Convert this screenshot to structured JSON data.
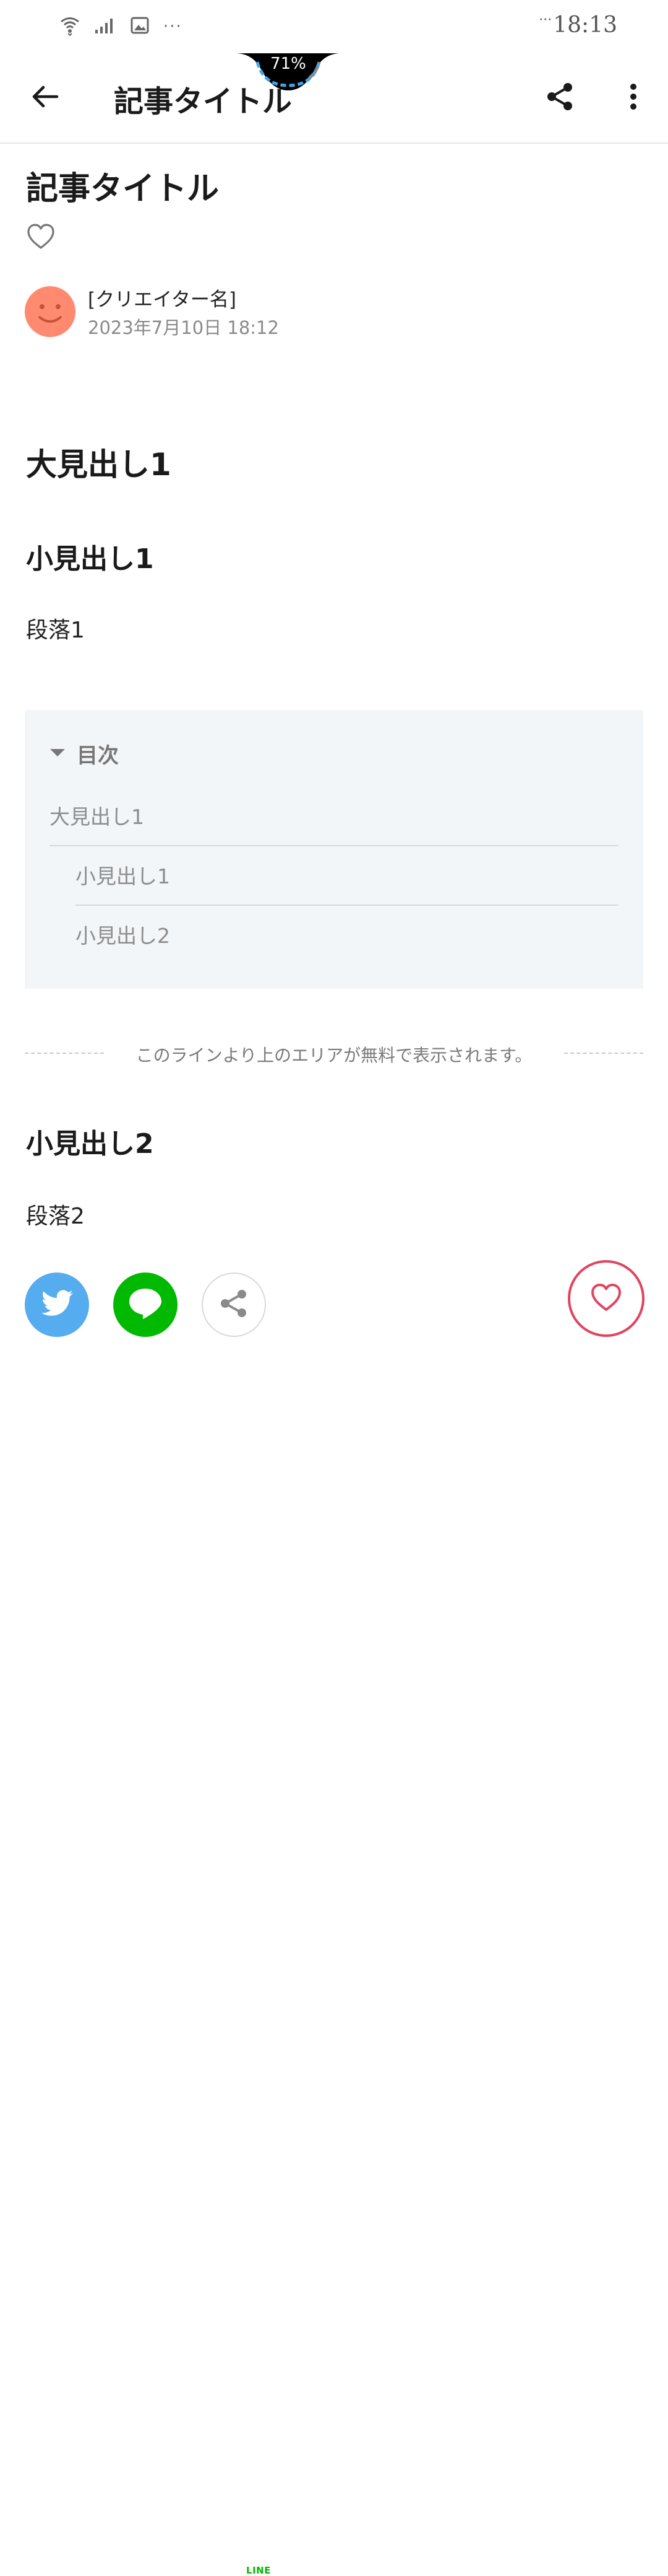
{
  "status_bar": {
    "overflow_dots": "···",
    "time_dots": "···",
    "time": "18:13",
    "icons": [
      "wifi-icon",
      "signal-icon",
      "image-icon"
    ]
  },
  "notch": {
    "battery_percent": "71%"
  },
  "app_bar": {
    "title": "記事タイトル",
    "icons": [
      "back-arrow-icon",
      "share-icon",
      "more-vert-icon"
    ]
  },
  "article": {
    "title": "記事タイトル",
    "author_name": "[クリエイター名]",
    "date": "2023年7月10日 18:12",
    "heading_large_1": "大見出し1",
    "heading_small_1": "小見出し1",
    "paragraph_1": "段落1",
    "heading_small_2": "小見出し2",
    "paragraph_2": "段落2"
  },
  "toc": {
    "label": "目次",
    "items": [
      {
        "label": "大見出し1",
        "level": 1
      },
      {
        "label": "小見出し1",
        "level": 2
      },
      {
        "label": "小見出し2",
        "level": 2
      }
    ]
  },
  "free_area_notice": "このラインより上のエリアが無料で表示されます。",
  "share_bar": {
    "line_logo_text": "LINE",
    "buttons": [
      "twitter-icon",
      "line-icon",
      "share-icon"
    ]
  },
  "colors": {
    "avatar": "#ff8a70",
    "twitter": "#55acee",
    "line": "#00b900",
    "like_accent": "#e0455f",
    "toc_background": "#f3f6f9"
  }
}
